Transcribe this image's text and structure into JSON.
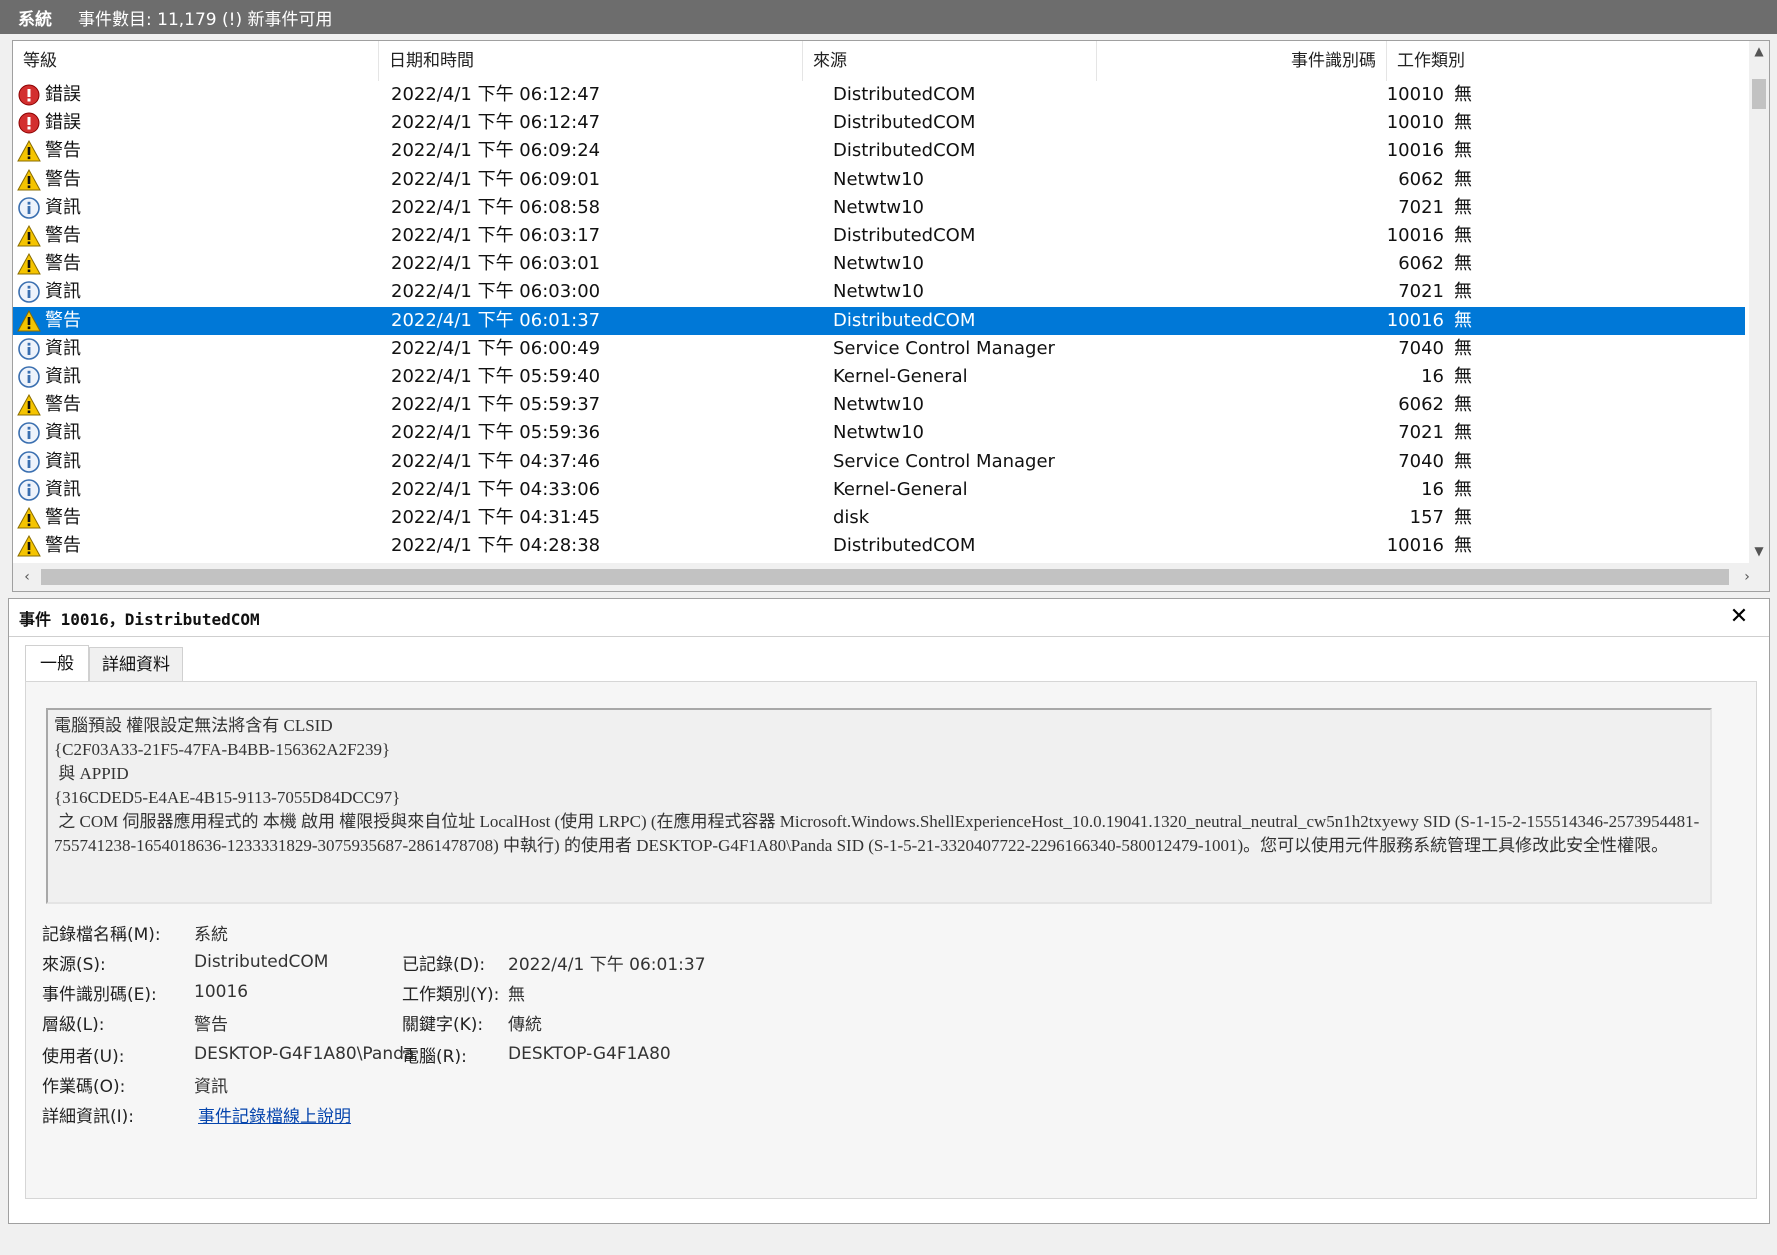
{
  "titlebar": {
    "name": "系統",
    "count_text": "事件數目: 11,179 (!) 新事件可用"
  },
  "columns": {
    "level": "等級",
    "date": "日期和時間",
    "source": "來源",
    "event_id": "事件識別碼",
    "task": "工作類別"
  },
  "events": [
    {
      "level": "錯誤",
      "icon": "error-icon",
      "date": "2022/4/1 下午 06:12:47",
      "source": "DistributedCOM",
      "event_id": "10010",
      "task": "無"
    },
    {
      "level": "錯誤",
      "icon": "error-icon",
      "date": "2022/4/1 下午 06:12:47",
      "source": "DistributedCOM",
      "event_id": "10010",
      "task": "無"
    },
    {
      "level": "警告",
      "icon": "warning-icon",
      "date": "2022/4/1 下午 06:09:24",
      "source": "DistributedCOM",
      "event_id": "10016",
      "task": "無"
    },
    {
      "level": "警告",
      "icon": "warning-icon",
      "date": "2022/4/1 下午 06:09:01",
      "source": "Netwtw10",
      "event_id": "6062",
      "task": "無"
    },
    {
      "level": "資訊",
      "icon": "info-icon",
      "date": "2022/4/1 下午 06:08:58",
      "source": "Netwtw10",
      "event_id": "7021",
      "task": "無"
    },
    {
      "level": "警告",
      "icon": "warning-icon",
      "date": "2022/4/1 下午 06:03:17",
      "source": "DistributedCOM",
      "event_id": "10016",
      "task": "無"
    },
    {
      "level": "警告",
      "icon": "warning-icon",
      "date": "2022/4/1 下午 06:03:01",
      "source": "Netwtw10",
      "event_id": "6062",
      "task": "無"
    },
    {
      "level": "資訊",
      "icon": "info-icon",
      "date": "2022/4/1 下午 06:03:00",
      "source": "Netwtw10",
      "event_id": "7021",
      "task": "無"
    },
    {
      "level": "警告",
      "icon": "warning-icon",
      "date": "2022/4/1 下午 06:01:37",
      "source": "DistributedCOM",
      "event_id": "10016",
      "task": "無",
      "selected": true
    },
    {
      "level": "資訊",
      "icon": "info-icon",
      "date": "2022/4/1 下午 06:00:49",
      "source": "Service Control Manager",
      "event_id": "7040",
      "task": "無"
    },
    {
      "level": "資訊",
      "icon": "info-icon",
      "date": "2022/4/1 下午 05:59:40",
      "source": "Kernel-General",
      "event_id": "16",
      "task": "無"
    },
    {
      "level": "警告",
      "icon": "warning-icon",
      "date": "2022/4/1 下午 05:59:37",
      "source": "Netwtw10",
      "event_id": "6062",
      "task": "無"
    },
    {
      "level": "資訊",
      "icon": "info-icon",
      "date": "2022/4/1 下午 05:59:36",
      "source": "Netwtw10",
      "event_id": "7021",
      "task": "無"
    },
    {
      "level": "資訊",
      "icon": "info-icon",
      "date": "2022/4/1 下午 04:37:46",
      "source": "Service Control Manager",
      "event_id": "7040",
      "task": "無"
    },
    {
      "level": "資訊",
      "icon": "info-icon",
      "date": "2022/4/1 下午 04:33:06",
      "source": "Kernel-General",
      "event_id": "16",
      "task": "無"
    },
    {
      "level": "警告",
      "icon": "warning-icon",
      "date": "2022/4/1 下午 04:31:45",
      "source": "disk",
      "event_id": "157",
      "task": "無"
    },
    {
      "level": "警告",
      "icon": "warning-icon",
      "date": "2022/4/1 下午 04:28:38",
      "source": "DistributedCOM",
      "event_id": "10016",
      "task": "無"
    }
  ],
  "detail": {
    "title": "事件 10016，DistributedCOM",
    "close_icon": "close-icon",
    "tabs": [
      "一般",
      "詳細資料"
    ],
    "description_lines": [
      "電腦預設 權限設定無法將含有 CLSID",
      "{C2F03A33-21F5-47FA-B4BB-156362A2F239}",
      " 與 APPID",
      "{316CDED5-E4AE-4B15-9113-7055D84DCC97}",
      " 之 COM 伺服器應用程式的 本機 啟用 權限授與來自位址 LocalHost (使用 LRPC) (在應用程式容器 Microsoft.Windows.ShellExperienceHost_10.0.19041.1320_neutral_neutral_cw5n1h2txyewy SID (S-1-15-2-155514346-2573954481-755741238-1654018636-1233331829-3075935687-2861478708) 中執行) 的使用者 DESKTOP-G4F1A80\\Panda SID (S-1-5-21-3320407722-2296166340-580012479-1001)。您可以使用元件服務系統管理工具修改此安全性權限。"
    ],
    "props": {
      "log_name_label": "記錄檔名稱(M):",
      "log_name": "系統",
      "source_label": "來源(S):",
      "source": "DistributedCOM",
      "logged_label": "已記錄(D):",
      "logged": "2022/4/1 下午 06:01:37",
      "event_id_label": "事件識別碼(E):",
      "event_id": "10016",
      "task_label": "工作類別(Y):",
      "task": "無",
      "level_label": "層級(L):",
      "level": "警告",
      "keywords_label": "關鍵字(K):",
      "keywords": "傳統",
      "user_label": "使用者(U):",
      "user": "DESKTOP-G4F1A80\\Panda",
      "computer_label": "電腦(R):",
      "computer": "DESKTOP-G4F1A80",
      "opcode_label": "作業碼(O):",
      "opcode": "資訊",
      "more_info_label": "詳細資訊(I):",
      "more_info_link": "事件記錄檔線上說明"
    }
  },
  "colors": {
    "selection": "#0078d7",
    "titlebar": "#6d6d6d",
    "error": "#d32f2f",
    "warning": "#f5c400",
    "info": "#3a6fb0",
    "link": "#0645ad"
  }
}
